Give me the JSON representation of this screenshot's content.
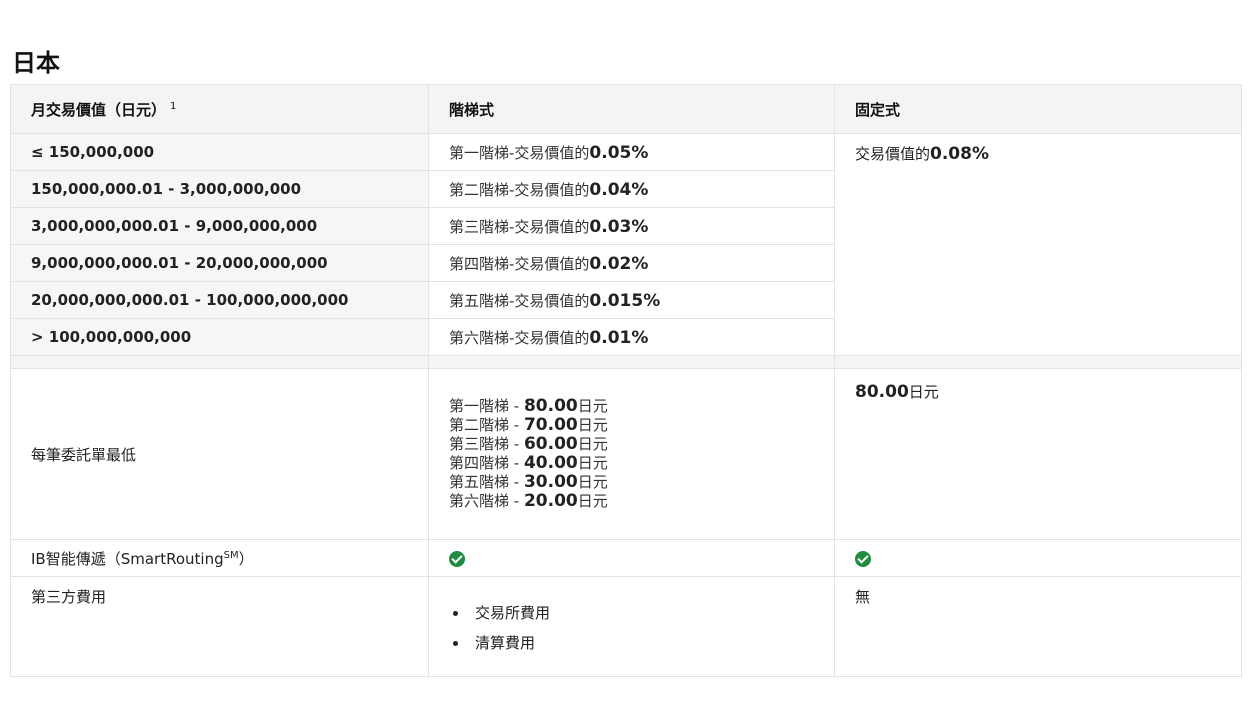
{
  "section_title": "日本",
  "table": {
    "headers": {
      "monthly_value": "月交易價值（日元）",
      "monthly_value_note": "1",
      "tiered": "階梯式",
      "fixed": "固定式"
    },
    "tiers": [
      {
        "range": "≤ 150,000,000",
        "rate_prefix": "第一階梯-交易價值的",
        "rate": "0.05%"
      },
      {
        "range": "150,000,000.01 - 3,000,000,000",
        "rate_prefix": "第二階梯-交易價值的",
        "rate": "0.04%"
      },
      {
        "range": "3,000,000,000.01 - 9,000,000,000",
        "rate_prefix": "第三階梯-交易價值的",
        "rate": "0.03%"
      },
      {
        "range": "9,000,000,000.01 - 20,000,000,000",
        "rate_prefix": "第四階梯-交易價值的",
        "rate": "0.02%"
      },
      {
        "range": "20,000,000,000.01 - 100,000,000,000",
        "rate_prefix": "第五階梯-交易價值的",
        "rate": "0.015%"
      },
      {
        "range": "> 100,000,000,000",
        "rate_prefix": "第六階梯-交易價值的",
        "rate": "0.01%"
      }
    ],
    "fixed_rate_prefix": "交易價值的",
    "fixed_rate": "0.08%",
    "minimum": {
      "label": "每筆委託單最低",
      "tiers": [
        {
          "prefix": "第一階梯 - ",
          "amount": "80.00",
          "unit": "日元"
        },
        {
          "prefix": "第二階梯 - ",
          "amount": "70.00",
          "unit": "日元"
        },
        {
          "prefix": "第三階梯 - ",
          "amount": "60.00",
          "unit": "日元"
        },
        {
          "prefix": "第四階梯 - ",
          "amount": "40.00",
          "unit": "日元"
        },
        {
          "prefix": "第五階梯 - ",
          "amount": "30.00",
          "unit": "日元"
        },
        {
          "prefix": "第六階梯 - ",
          "amount": "20.00",
          "unit": "日元"
        }
      ],
      "fixed_amount": "80.00",
      "fixed_unit": "日元"
    },
    "smart_routing": {
      "label": "IB智能傳遞（SmartRouting",
      "label_sup": "SM",
      "label_end": "）",
      "tiered_included": true,
      "fixed_included": true,
      "check_color": "#1e8e3e"
    },
    "third_party": {
      "label": "第三方費用",
      "tiered_items": [
        "交易所費用",
        "清算費用"
      ],
      "fixed_value": "無"
    }
  }
}
